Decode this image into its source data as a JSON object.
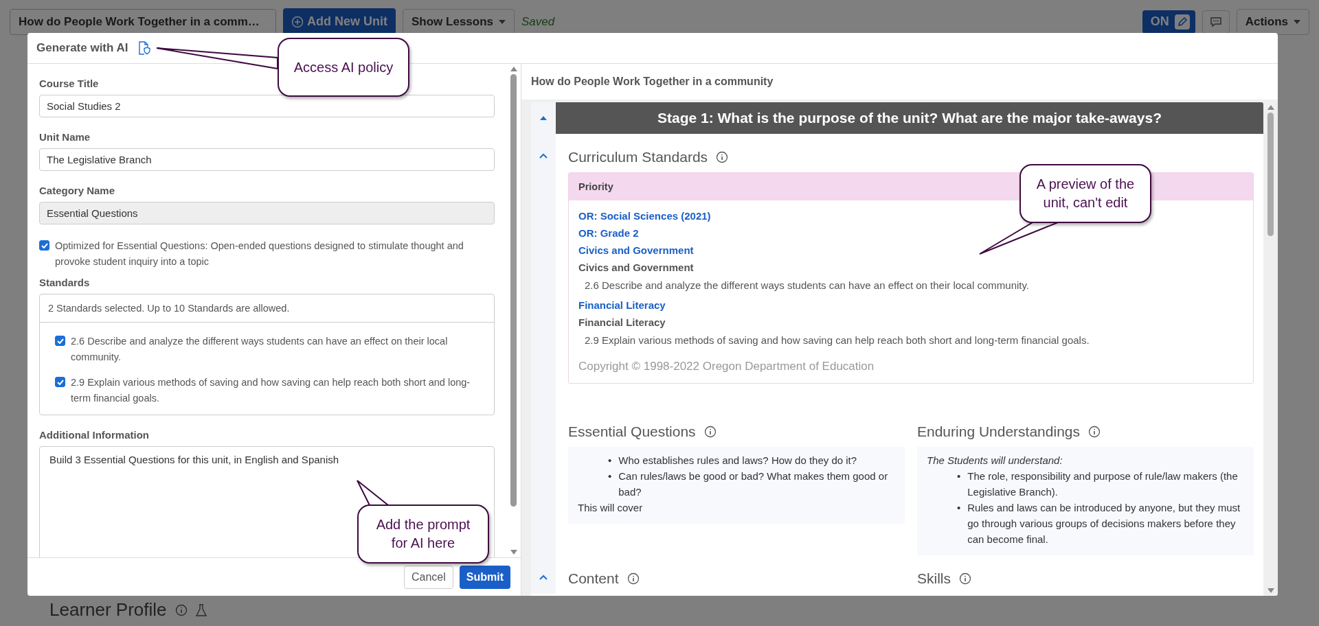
{
  "page": {
    "unit_select": "How do People Work Together in a comm…",
    "add_unit_button": "Add New Unit",
    "lessons_menu": "Show Lessons",
    "save_status": "Saved",
    "edit_switch": {
      "label": "ON",
      "on": true
    },
    "actions_menu": "Actions",
    "section_heading": "Learner Profile"
  },
  "dialog": {
    "title": "Generate with AI",
    "form": {
      "course_title": {
        "label": "Course Title",
        "value": "Social Studies 2"
      },
      "unit_name": {
        "label": "Unit Name",
        "value": "The Legislative Branch"
      },
      "category_name": {
        "label": "Category Name",
        "value": "Essential Questions",
        "disabled": true
      },
      "optimized_option": {
        "label": "Optimized for Essential Questions: Open-ended questions designed to stimulate thought and provoke student inquiry into a topic",
        "checked": true
      },
      "standards": {
        "label": "Standards",
        "summary": "2 Standards selected. Up to 10 Standards are allowed.",
        "items": [
          {
            "text": "2.6 Describe and analyze the different ways students can have an effect on their local community.",
            "checked": true
          },
          {
            "text": "2.9 Explain various methods of saving and how saving can help reach both short and long-term financial goals.",
            "checked": true
          }
        ]
      },
      "additional_information": {
        "label": "Additional Information",
        "value": "Build 3 Essential Questions for this unit, in English and Spanish"
      }
    },
    "buttons": {
      "cancel": "Cancel",
      "submit": "Submit"
    },
    "preview": {
      "title": "How do People Work Together in a community",
      "stage_heading": "Stage 1: What is the purpose of the unit? What are the major take-aways?",
      "rows": [
        {
          "expanded": true,
          "sections": [
            {
              "kind": "standards",
              "heading": "Curriculum Standards",
              "group": "Priority",
              "lines": [
                {
                  "kind": "link",
                  "text": "OR: Social Sciences (2021)"
                },
                {
                  "kind": "link",
                  "text": "OR: Grade 2"
                },
                {
                  "kind": "link",
                  "text": "Civics and Government"
                },
                {
                  "kind": "heading",
                  "text": "Civics and Government"
                },
                {
                  "kind": "standard",
                  "text": "2.6 Describe and analyze the different ways students can have an effect on their local community."
                },
                {
                  "kind": "link",
                  "text": "Financial Literacy"
                },
                {
                  "kind": "heading",
                  "text": "Financial Literacy"
                },
                {
                  "kind": "standard",
                  "text": "2.9 Explain various methods of saving and how saving can help reach both short and long-term financial goals."
                }
              ],
              "copyright": "Copyright © 1998-2022 Oregon Department of Education"
            }
          ]
        },
        {
          "sections": [
            {
              "kind": "list",
              "heading": "Essential Questions",
              "marker": "•",
              "bullets": [
                "Who establishes rules and laws? How do they do it?",
                "Can rules/laws be good or bad? What makes them good or bad?"
              ],
              "note": "This will cover"
            },
            {
              "kind": "list",
              "heading": "Enduring Understandings",
              "intro": "The Students will understand:",
              "marker": "•",
              "bullets": [
                "The role, responsibility and purpose of rule/law makers (the Legislative Branch).",
                "Rules and laws can be introduced by anyone, but they must go through various groups of decisions makers before they can become final."
              ]
            }
          ]
        },
        {
          "expanded": true,
          "sections": [
            {
              "kind": "heading",
              "heading": "Content"
            },
            {
              "kind": "heading",
              "heading": "Skills"
            }
          ]
        }
      ]
    }
  },
  "callouts": [
    {
      "text": "Access AI policy"
    },
    {
      "text": "A preview of the unit, can't edit"
    },
    {
      "text": "Add the prompt for AI here"
    }
  ]
}
